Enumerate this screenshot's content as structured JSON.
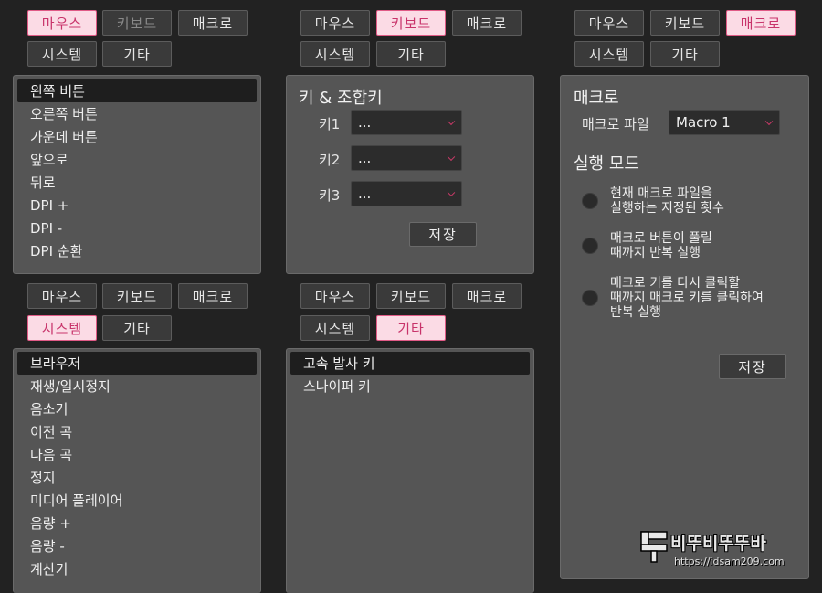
{
  "tab_labels": {
    "mouse": "마우스",
    "keyboard": "키보드",
    "macro": "매크로",
    "system": "시스템",
    "other": "기타"
  },
  "mouse_panel": {
    "items": [
      "왼쪽 버튼",
      "오른쪽 버튼",
      "가운데 버튼",
      "앞으로",
      "뒤로",
      "DPI +",
      "DPI -",
      "DPI 순환"
    ]
  },
  "keyboard_panel": {
    "title": "키 & 조합키",
    "key1_label": "키1",
    "key2_label": "키2",
    "key3_label": "키3",
    "key1_value": "...",
    "key2_value": "...",
    "key3_value": "...",
    "save_label": "저장"
  },
  "macro_panel": {
    "title": "매크로",
    "file_label": "매크로 파일",
    "file_value": "Macro 1",
    "mode_title": "실행 모드",
    "options": [
      "현재 매크로 파일을\n실행하는 지정된 횟수",
      "매크로 버튼이 풀릴\n때까지 반복 실행",
      "매크로 키를 다시 클릭할\n때까지 매크로 키를 클릭하여\n반복 실행"
    ],
    "save_label": "저장"
  },
  "system_panel": {
    "items": [
      "브라우저",
      "재생/일시정지",
      "음소거",
      "이전 곡",
      "다음 곡",
      "정지",
      "미디어 플레이어",
      "음량 +",
      "음량 -",
      "계산기"
    ]
  },
  "other_panel": {
    "items": [
      "고속 발사 키",
      "스나이퍼 키"
    ]
  },
  "watermark": {
    "title": "비뚜비뚜뚜바",
    "url": "https://idsam209.com"
  },
  "colors": {
    "background": "#222222",
    "panel": "#555555",
    "active_tab_bg": "#fbdbe5",
    "active_tab_border": "#e05a86",
    "accent": "#d03a6a"
  }
}
